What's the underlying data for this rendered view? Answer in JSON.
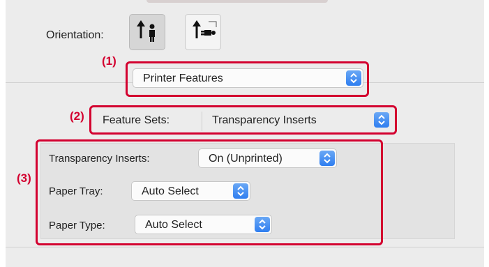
{
  "orientation": {
    "label": "Orientation:",
    "options": [
      "portrait-icon",
      "landscape-icon"
    ],
    "selected": "portrait"
  },
  "callouts": [
    "(1)",
    "(2)",
    "(3)"
  ],
  "section_popup": {
    "value": "Printer Features"
  },
  "feature_sets": {
    "label": "Feature Sets:",
    "value": "Transparency Inserts"
  },
  "settings": {
    "transparency_inserts": {
      "label": "Transparency Inserts:",
      "value": "On (Unprinted)"
    },
    "paper_tray": {
      "label": "Paper Tray:",
      "value": "Auto Select"
    },
    "paper_type": {
      "label": "Paper Type:",
      "value": "Auto Select"
    }
  },
  "colors": {
    "callout_red": "#d3002f",
    "stepper_blue": "#2f7ef0",
    "panel_bg": "#ececec"
  }
}
